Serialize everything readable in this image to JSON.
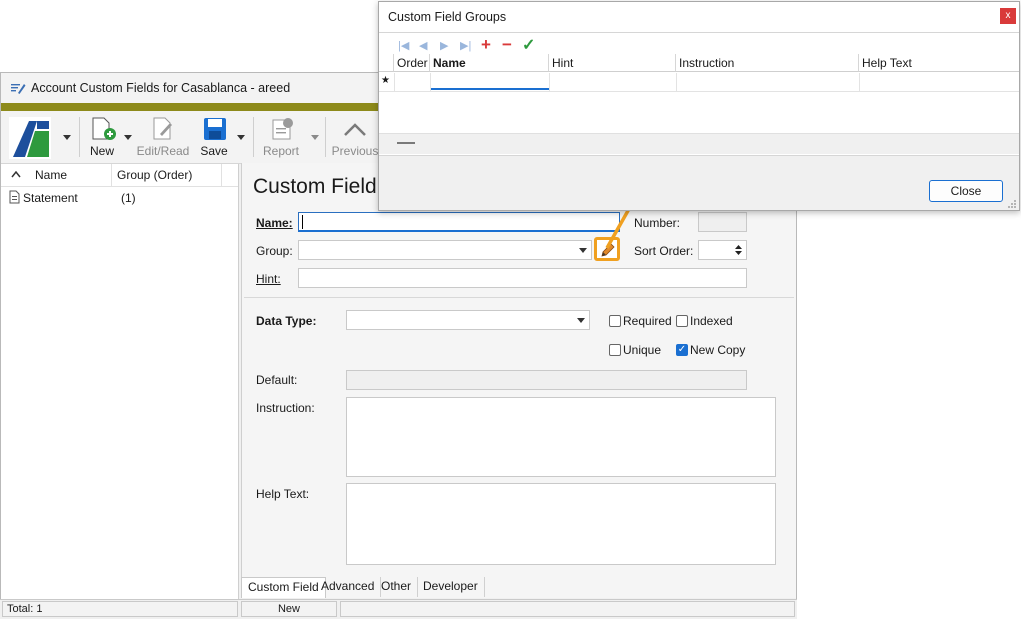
{
  "main_window": {
    "title": "Account Custom Fields for Casablanca - areed",
    "toolbar": {
      "new_label": "New",
      "edit_read_label": "Edit/Read",
      "save_label": "Save",
      "report_label": "Report",
      "previous_label": "Previous"
    },
    "list": {
      "col_name": "Name",
      "col_group": "Group (Order)",
      "rows": [
        {
          "name": "Statement",
          "group": "(1)"
        }
      ]
    },
    "detail": {
      "heading": "Custom Field",
      "name_label": "Name:",
      "number_label": "Number:",
      "group_label": "Group:",
      "sort_order_label": "Sort Order:",
      "hint_label": "Hint:",
      "data_type_label": "Data Type:",
      "required_label": "Required",
      "indexed_label": "Indexed",
      "unique_label": "Unique",
      "new_copy_label": "New Copy",
      "default_label": "Default:",
      "instruction_label": "Instruction:",
      "help_text_label": "Help Text:",
      "new_copy_checked": true
    },
    "tabs": [
      "Custom Field",
      "Advanced",
      "Other",
      "Developer"
    ],
    "status": {
      "total": "Total: 1",
      "mode": "New"
    }
  },
  "dialog": {
    "title": "Custom Field Groups",
    "close_x": "x",
    "columns": [
      "Order",
      "Name",
      "Hint",
      "Instruction",
      "Help Text"
    ],
    "new_row_marker": "★",
    "close_label": "Close"
  },
  "colors": {
    "accent_bar": "#8d8a1a",
    "highlight": "#f0a020",
    "select_blue": "#1a6fd1"
  }
}
